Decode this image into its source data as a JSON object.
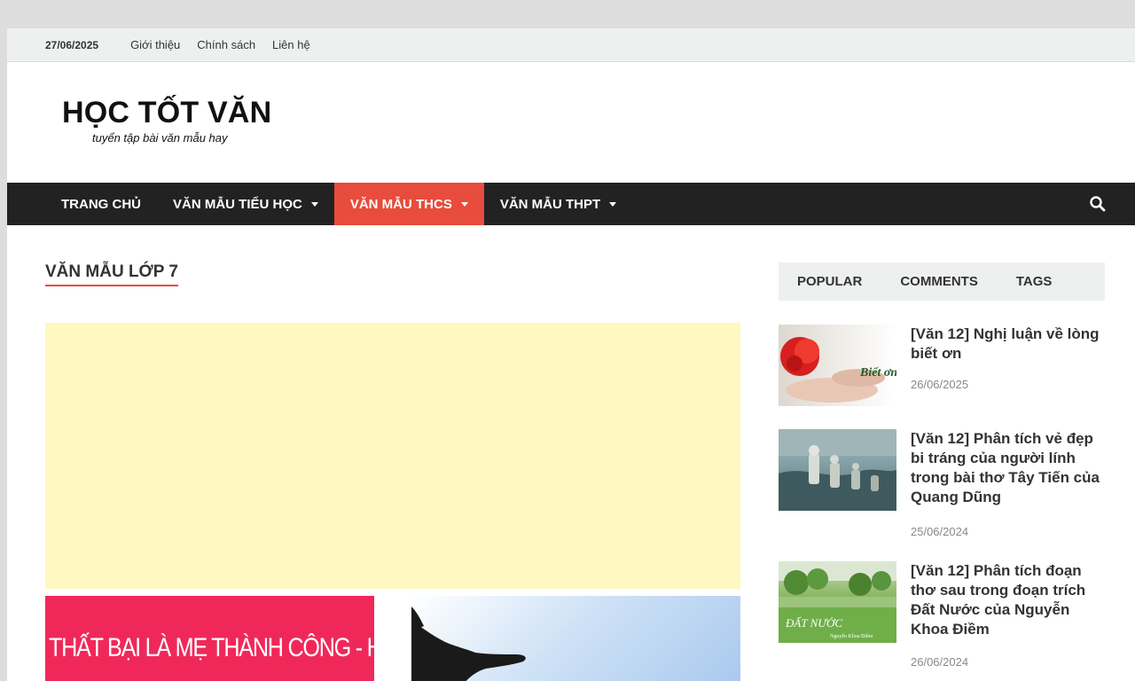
{
  "topbar": {
    "date": "27/06/2025",
    "links": [
      "Giới thiệu",
      "Chính sách",
      "Liên hệ"
    ]
  },
  "site": {
    "title": "HỌC TỐT VĂN",
    "tagline": "tuyển tập bài văn mẫu hay"
  },
  "nav": {
    "items": [
      {
        "label": "TRANG CHỦ",
        "dropdown": false,
        "active": false
      },
      {
        "label": "VĂN MẪU TIỂU HỌC",
        "dropdown": true,
        "active": false
      },
      {
        "label": "VĂN MẪU THCS",
        "dropdown": true,
        "active": true
      },
      {
        "label": "VĂN MẪU THPT",
        "dropdown": true,
        "active": false
      }
    ]
  },
  "main": {
    "section_title": "VĂN MẪU LỚP 7",
    "thumb_text": "THẤT BẠI LÀ MẸ THÀNH CÔNG - HIỂU THẾ NÀO?"
  },
  "sidebar": {
    "tabs": [
      "POPULAR",
      "COMMENTS",
      "TAGS"
    ],
    "posts": [
      {
        "title": "[Văn 12] Nghị luận về lòng biết ơn",
        "date": "26/06/2025",
        "image_text": "Biết ơn"
      },
      {
        "title": "[Văn 12] Phân tích vẻ đẹp bi tráng của người lính trong bài thơ Tây Tiến của Quang Dũng",
        "date": "25/06/2024"
      },
      {
        "title": "[Văn 12] Phân tích đoạn thơ sau trong đoạn trích Đất Nước của Nguyễn Khoa Điềm",
        "date": "26/06/2024",
        "image_text": "ĐẤT NƯỚC",
        "image_subtext": "Nguyễn Khoa Điềm"
      }
    ]
  },
  "colors": {
    "accent": "#e74c3c",
    "nav_bg": "#222222",
    "ad_bg": "#fff8c0",
    "thumb_red": "#f0285a"
  }
}
